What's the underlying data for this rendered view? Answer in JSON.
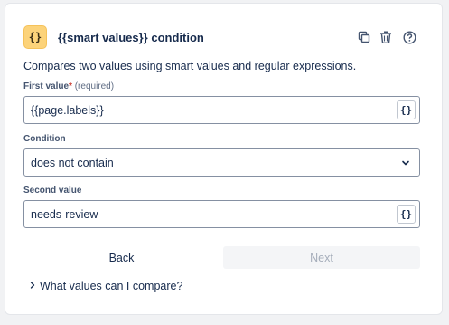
{
  "header": {
    "badge_text": "{}",
    "title": "{{smart values}} condition",
    "icons": [
      "duplicate-icon",
      "trash-icon",
      "help-icon"
    ]
  },
  "description": "Compares two values using smart values and regular expressions.",
  "first_value": {
    "label": "First value",
    "required_marker": "*",
    "required_hint": "(required)",
    "value": "{{page.labels}}",
    "smart_button": "{}"
  },
  "condition": {
    "label": "Condition",
    "selected": "does not contain"
  },
  "second_value": {
    "label": "Second value",
    "value": "needs-review",
    "smart_button": "{}"
  },
  "buttons": {
    "back": "Back",
    "next": "Next"
  },
  "help": {
    "label": "What values can I compare?"
  },
  "colors": {
    "badge": "#fcd37a",
    "required": "#c9372c",
    "disabled_text": "#a5adba"
  }
}
